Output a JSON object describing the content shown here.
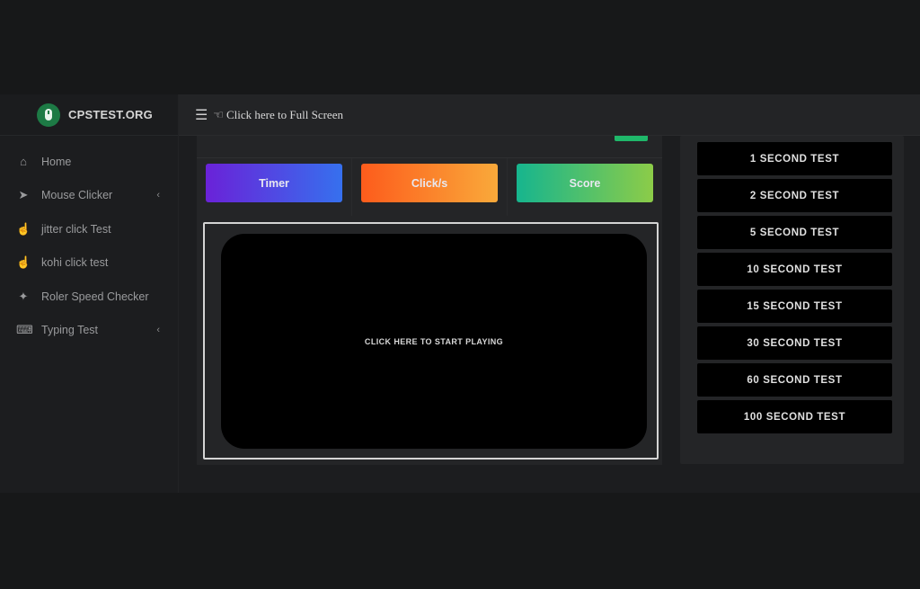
{
  "brand": {
    "name": "CPSTEST.ORG",
    "logo_icon": "mouse-icon"
  },
  "header": {
    "menu_icon": "hamburger-icon",
    "fullscreen_icon": "fullscreen-hand-icon",
    "fullscreen_label": "Click here to Full Screen"
  },
  "sidebar": {
    "items": [
      {
        "label": "Home",
        "icon": "home-icon",
        "glyph": "⌂",
        "has_submenu": false
      },
      {
        "label": "Mouse Clicker",
        "icon": "cursor-icon",
        "glyph": "➤",
        "has_submenu": true
      },
      {
        "label": "jitter click Test",
        "icon": "pointer-hand-icon",
        "glyph": "☝",
        "has_submenu": false
      },
      {
        "label": "kohi click test",
        "icon": "pointer-hand-icon",
        "glyph": "☝",
        "has_submenu": false
      },
      {
        "label": "Roler Speed Checker",
        "icon": "crosshair-icon",
        "glyph": "✦",
        "has_submenu": false
      },
      {
        "label": "Typing Test",
        "icon": "keyboard-icon",
        "glyph": "⌨",
        "has_submenu": true
      }
    ],
    "submenu_glyph": "‹"
  },
  "stats": {
    "timer_label": "Timer",
    "clicks_label": "Click/s",
    "score_label": "Score"
  },
  "colors": {
    "accent_green": "#1fb86a",
    "timer_gradient": [
      "#6a22d8",
      "#3670ee"
    ],
    "clicks_gradient": [
      "#fd5c1c",
      "#f9a93a"
    ],
    "score_gradient": [
      "#16b58e",
      "#8ccc48"
    ]
  },
  "play_area": {
    "label": "CLICK HERE TO START PLAYING"
  },
  "tests": [
    "1 SECOND TEST",
    "2 SECOND TEST",
    "5 SECOND TEST",
    "10 SECOND TEST",
    "15 SECOND TEST",
    "30 SECOND TEST",
    "60 SECOND TEST",
    "100 SECOND TEST"
  ]
}
